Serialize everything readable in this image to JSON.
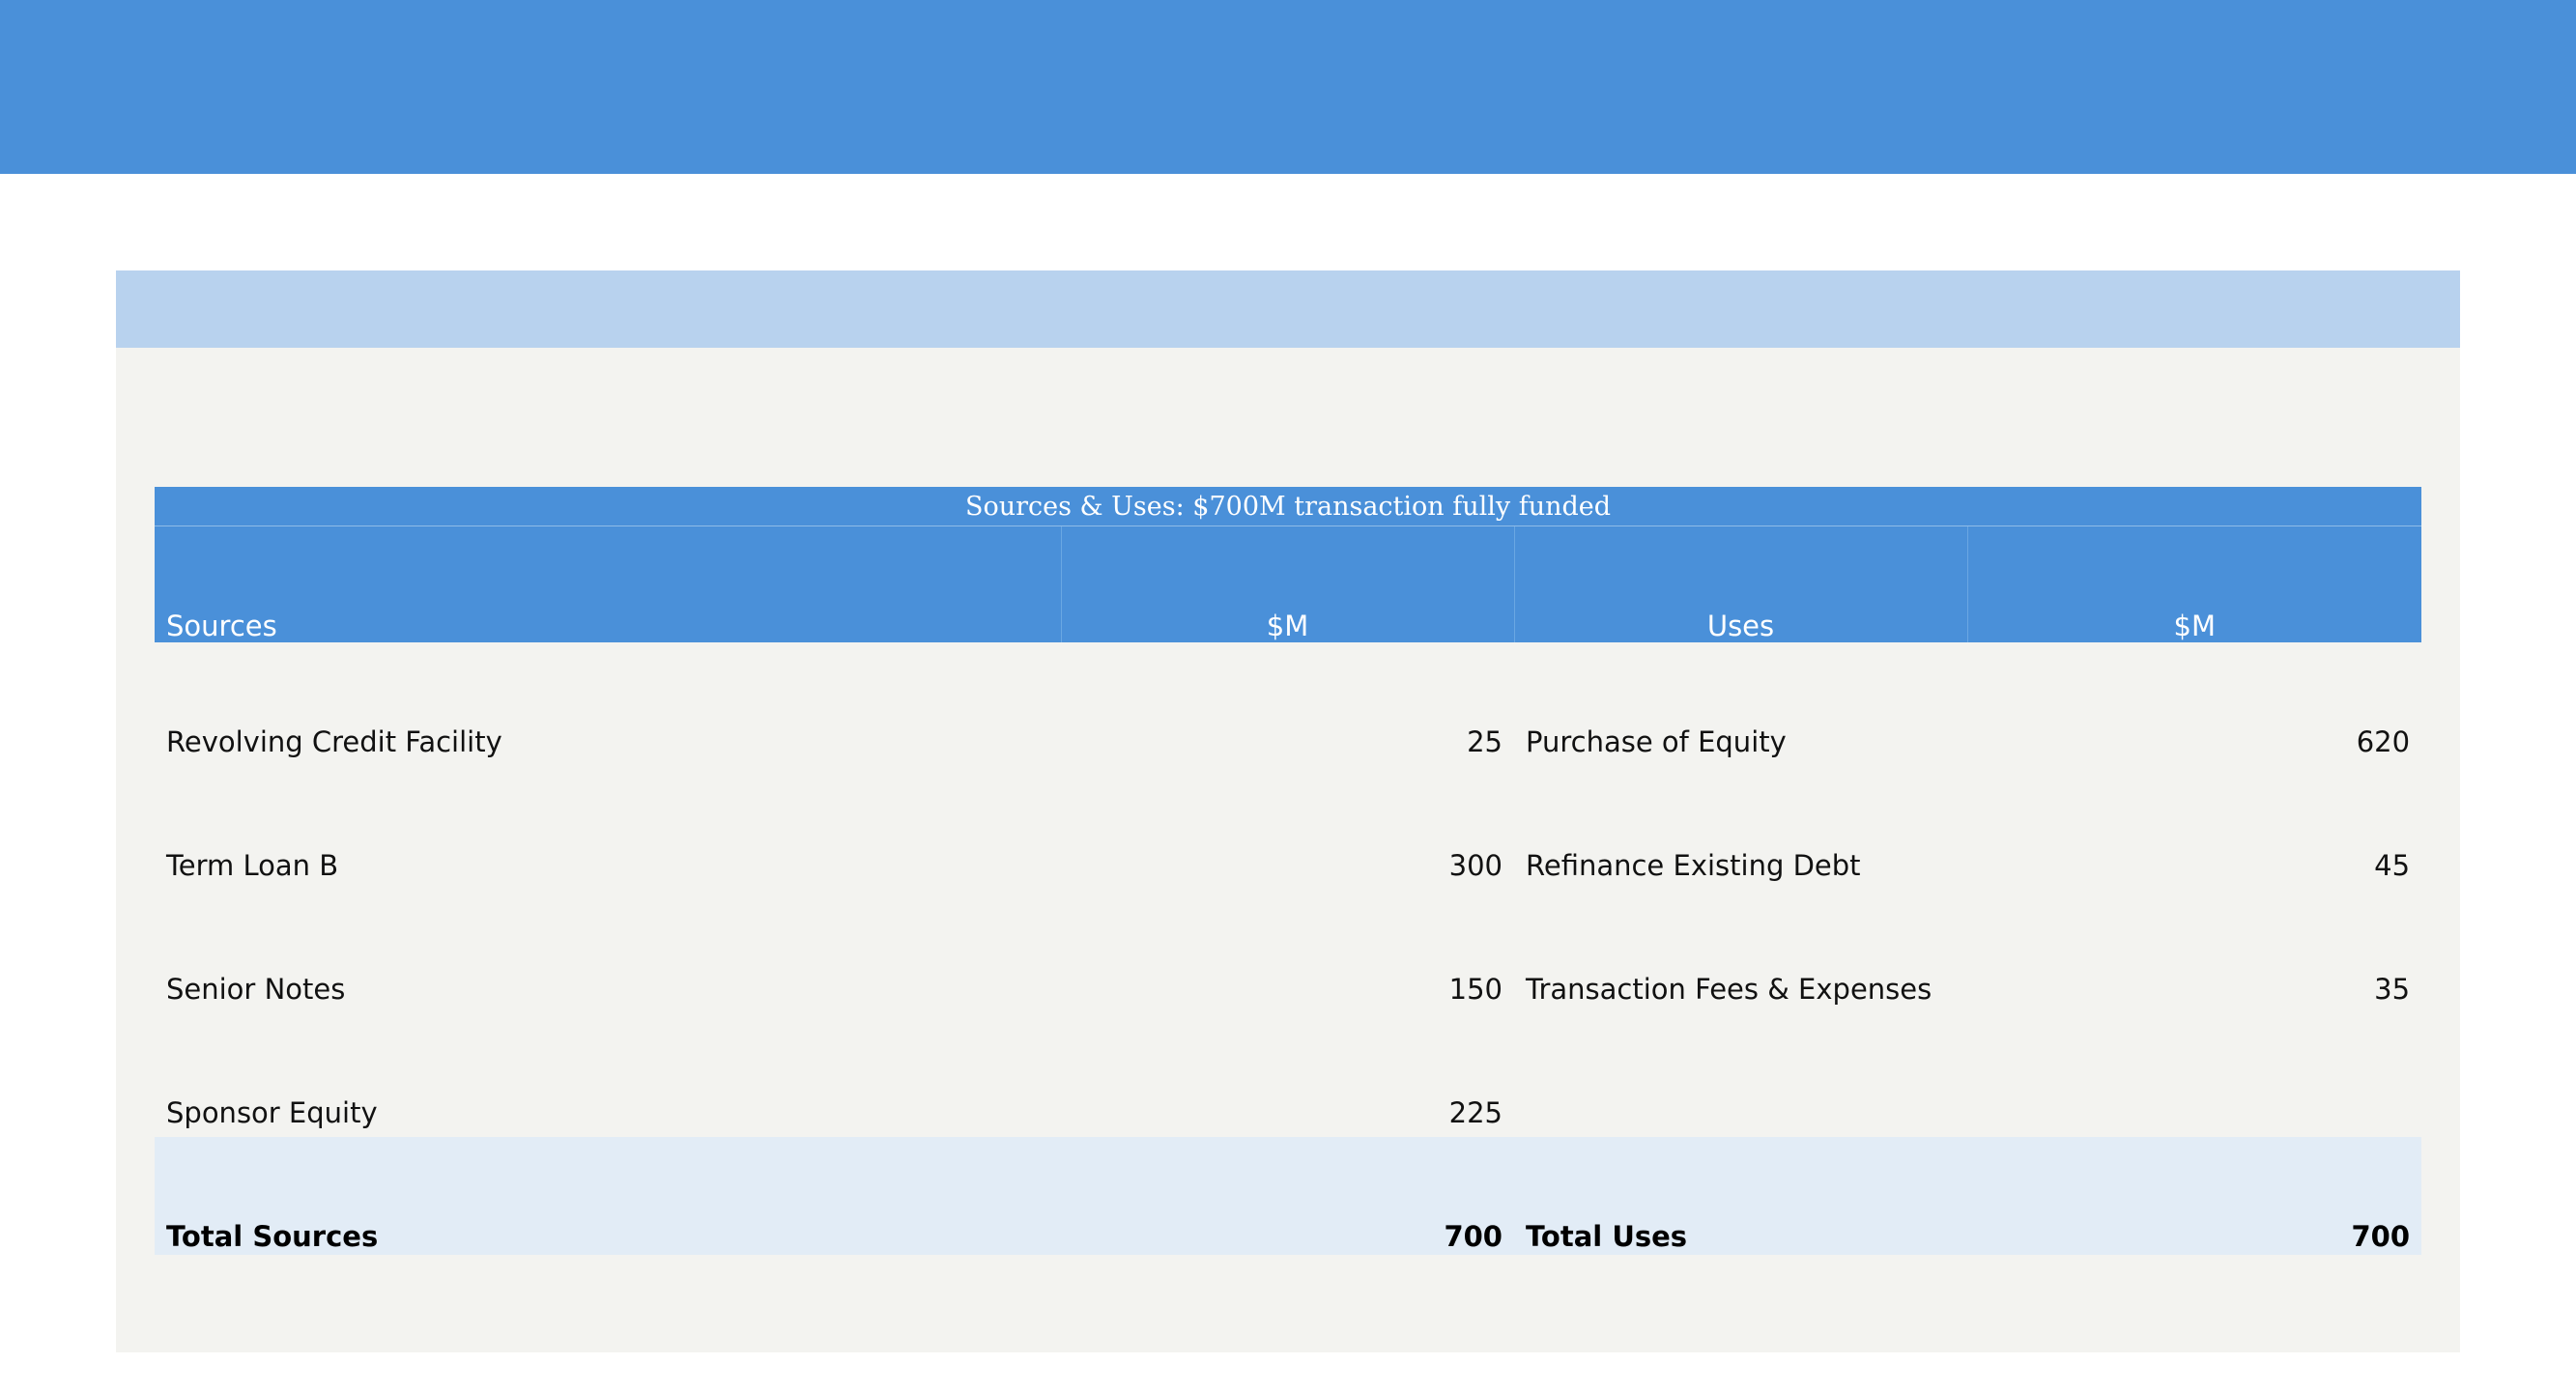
{
  "table": {
    "title": "Sources & Uses: $700M transaction fully funded",
    "headers": [
      "Sources",
      "$M",
      "Uses",
      "$M"
    ],
    "rows": [
      {
        "source": "Revolving Credit Facility",
        "source_amt": "25",
        "use": "Purchase of Equity",
        "use_amt": "620"
      },
      {
        "source": "Term Loan B",
        "source_amt": "300",
        "use": "Refinance Existing Debt",
        "use_amt": "45"
      },
      {
        "source": "Senior Notes",
        "source_amt": "150",
        "use": "Transaction Fees & Expenses",
        "use_amt": "35"
      },
      {
        "source": "Sponsor Equity",
        "source_amt": "225",
        "use": "",
        "use_amt": ""
      }
    ],
    "total": {
      "source": "Total Sources",
      "source_amt": "700",
      "use": "Total Uses",
      "use_amt": "700"
    }
  },
  "colors": {
    "band": "#4a90d9",
    "card_header": "#b8d2ee",
    "card_bg": "#f3f3f0",
    "total_bg": "#e2ecf6"
  }
}
